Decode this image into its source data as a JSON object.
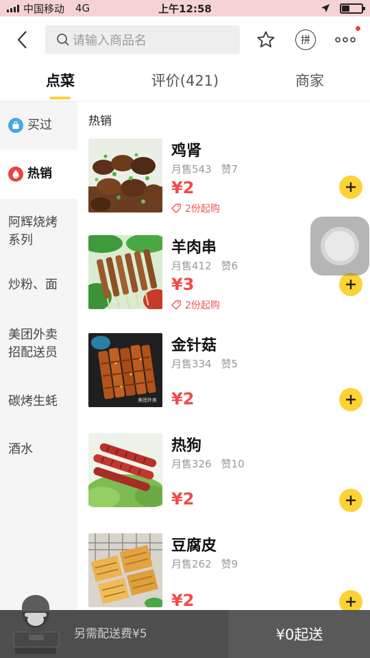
{
  "status_bar": {
    "carrier": "中国移动",
    "network": "4G",
    "time": "上午12:58"
  },
  "header": {
    "search_placeholder": "请输入商品名",
    "pin_label": "拼"
  },
  "tabs": [
    {
      "label": "点菜",
      "active": true
    },
    {
      "label": "评价(421)",
      "active": false
    },
    {
      "label": "商家",
      "active": false
    }
  ],
  "sidebar": {
    "items": [
      {
        "label": "买过",
        "icon": "bag-icon"
      },
      {
        "label": "热销",
        "icon": "flame-icon",
        "active": true
      },
      {
        "label": "阿辉烧烤系列"
      },
      {
        "label": "炒粉、面"
      },
      {
        "label": "美团外卖招配送员"
      },
      {
        "label": "碳烤生蚝"
      },
      {
        "label": "酒水"
      }
    ]
  },
  "content": {
    "section_title": "热销",
    "items": [
      {
        "name": "鸡肾",
        "monthly_sales": "月售543",
        "likes": "赞7",
        "price": "¥2",
        "min_order": "2份起购"
      },
      {
        "name": "羊肉串",
        "monthly_sales": "月售412",
        "likes": "赞6",
        "price": "¥3",
        "min_order": "2份起购"
      },
      {
        "name": "金针菇",
        "monthly_sales": "月售334",
        "likes": "赞5",
        "price": "¥2",
        "image_watermark": "美团外卖"
      },
      {
        "name": "热狗",
        "monthly_sales": "月售326",
        "likes": "赞10",
        "price": "¥2"
      },
      {
        "name": "豆腐皮",
        "monthly_sales": "月售262",
        "likes": "赞9",
        "price": "¥2"
      }
    ]
  },
  "bottom_bar": {
    "delivery_fee": "另需配送费¥5",
    "min_order_label": "¥0起送"
  },
  "colors": {
    "accent": "#ffd234",
    "price": "#f24a4a",
    "bottom_bar": "#4e4e4e"
  }
}
